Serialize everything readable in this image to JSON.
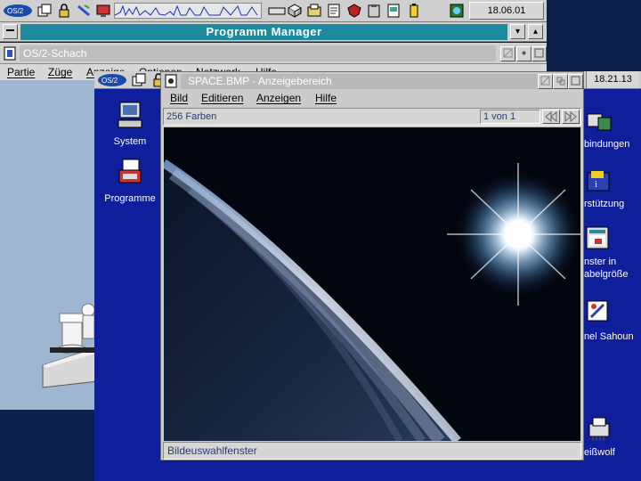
{
  "taskbar": {
    "clock": "18.06.01",
    "icons": [
      "os2-logo-icon",
      "window-list-icon",
      "lock-icon",
      "shredder-icon",
      "system-monitor-icon",
      "cpu-graph",
      "drive-icon",
      "package-icon",
      "folder-icon",
      "notes-icon",
      "shield-icon",
      "clipboard-icon",
      "document-icon",
      "battery-icon",
      "globe-icon"
    ]
  },
  "program_manager": {
    "title": "Programm Manager"
  },
  "chess_window": {
    "title": "OS/2-Schach",
    "menu": [
      "Partie",
      "Züge",
      "Anzeige",
      "Optionen",
      "Netzwerk",
      "Hilfe"
    ]
  },
  "desktop": {
    "clock": "18.21.13",
    "icons_left": [
      "System",
      "Programme"
    ],
    "icons_right": [
      "bindungen",
      "rstützung",
      "nster in",
      "abelgröße",
      "nel Sahoun",
      "eißwolf"
    ]
  },
  "viewer": {
    "title": "SPACE.BMP - Anzeigebereich",
    "menu": [
      "Bild",
      "Editieren",
      "Anzeigen",
      "Hilfe"
    ],
    "colors_label": "256 Farben",
    "page_label": "1 von 1",
    "footer": "Bildeuswahlfenster"
  },
  "colors": {
    "desktop_blue": "#0f1e9a",
    "pm_title": "#1e8a9e",
    "chess_bg": "#a9bfd6"
  }
}
